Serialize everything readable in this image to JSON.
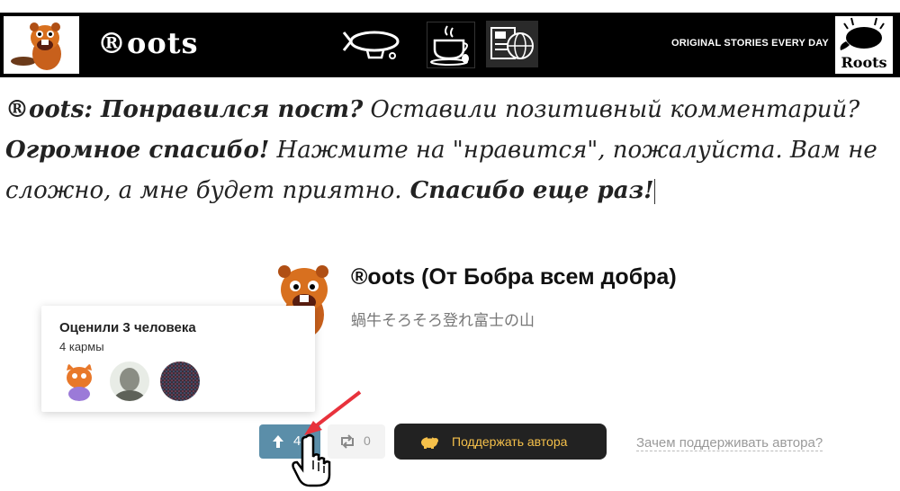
{
  "header": {
    "brand": "®oots",
    "tagline": "ORIGINAL STORIES EVERY DAY",
    "badge_text": "Roots",
    "nav_icons": [
      "airship-icon",
      "coffee-cup-icon",
      "news-globe-icon"
    ]
  },
  "message": {
    "part1_bold": "®oots: Понравился пост?",
    "part2": " Оставили позитивный комментарий?",
    "part3_bold": "Огромное спасибо!",
    "part4": " Нажмите на \"нравится\", пожалуйста. Вам не сложно, а мне будет приятно.",
    "part5_bold": " Спасибо еще раз!"
  },
  "author": {
    "name": "®oots (От Бобра всем добра)",
    "subtitle": "蝸牛そろそろ登れ富士の山"
  },
  "popup": {
    "title": "Оценили 3 человека",
    "karma": "4 кармы"
  },
  "actions": {
    "vote_count": "4",
    "repost_count": "0",
    "support_label": "Поддержать автора",
    "why_support_label": "Зачем поддерживать автора?"
  },
  "colors": {
    "vote_button": "#5b8ea9",
    "support_button": "#222222",
    "support_text": "#f5c04a",
    "arrow": "#e8323c"
  }
}
